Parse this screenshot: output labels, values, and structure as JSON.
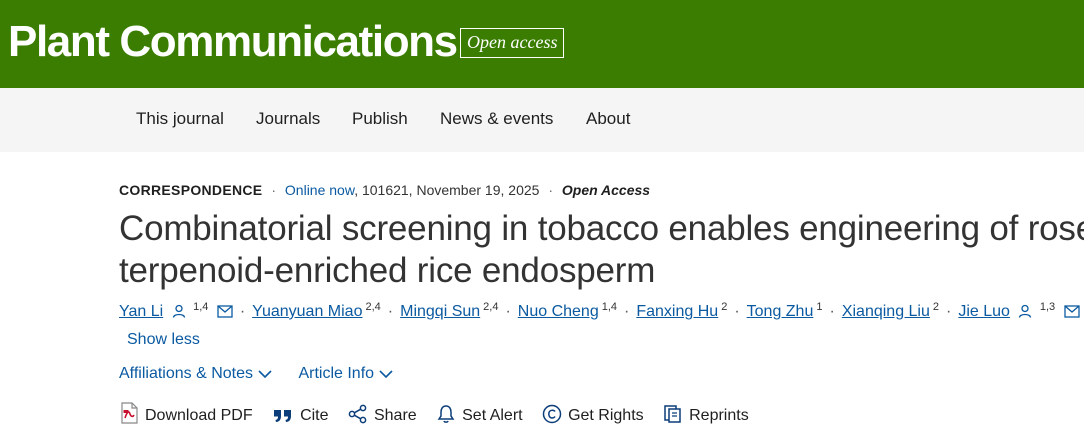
{
  "header": {
    "journal_title": "Plant Communications",
    "open_access_badge": "Open access"
  },
  "nav": {
    "items": [
      {
        "label": "This journal"
      },
      {
        "label": "Journals"
      },
      {
        "label": "Publish"
      },
      {
        "label": "News & events"
      },
      {
        "label": "About"
      }
    ]
  },
  "article": {
    "type": "CORRESPONDENCE",
    "online_label": "Online now",
    "article_number_date": ", 101621, November 19, 2025",
    "access": "Open Access",
    "title_lines": [
      "Combinatorial screening in tobacco enables engineering of rose",
      "terpenoid-enriched rice endosperm"
    ],
    "authors": [
      {
        "name": "Yan Li",
        "sup": "1,4",
        "has_person_icon": true,
        "has_email_icon": true
      },
      {
        "name": "Yuanyuan Miao",
        "sup": "2,4"
      },
      {
        "name": "Mingqi Sun",
        "sup": "2,4"
      },
      {
        "name": "Nuo Cheng",
        "sup": "1,4"
      },
      {
        "name": "Fanxing Hu",
        "sup": "2"
      },
      {
        "name": "Tong Zhu",
        "sup": "1"
      },
      {
        "name": "Xianqing Liu",
        "sup": "2"
      },
      {
        "name": "Jie Luo",
        "sup": "1,3",
        "has_person_icon": true,
        "has_email_icon": true
      }
    ],
    "show_less": "Show less",
    "toggles": {
      "affiliations": "Affiliations & Notes",
      "article_info": "Article Info"
    },
    "actions": {
      "download_pdf": "Download PDF",
      "cite": "Cite",
      "share": "Share",
      "set_alert": "Set Alert",
      "get_rights": "Get Rights",
      "reprints": "Reprints"
    }
  },
  "colors": {
    "brand_green": "#3a7d00",
    "link_blue": "#0b5aa1",
    "nav_bg": "#f5f5f5",
    "pdf_red": "#c8102e"
  }
}
